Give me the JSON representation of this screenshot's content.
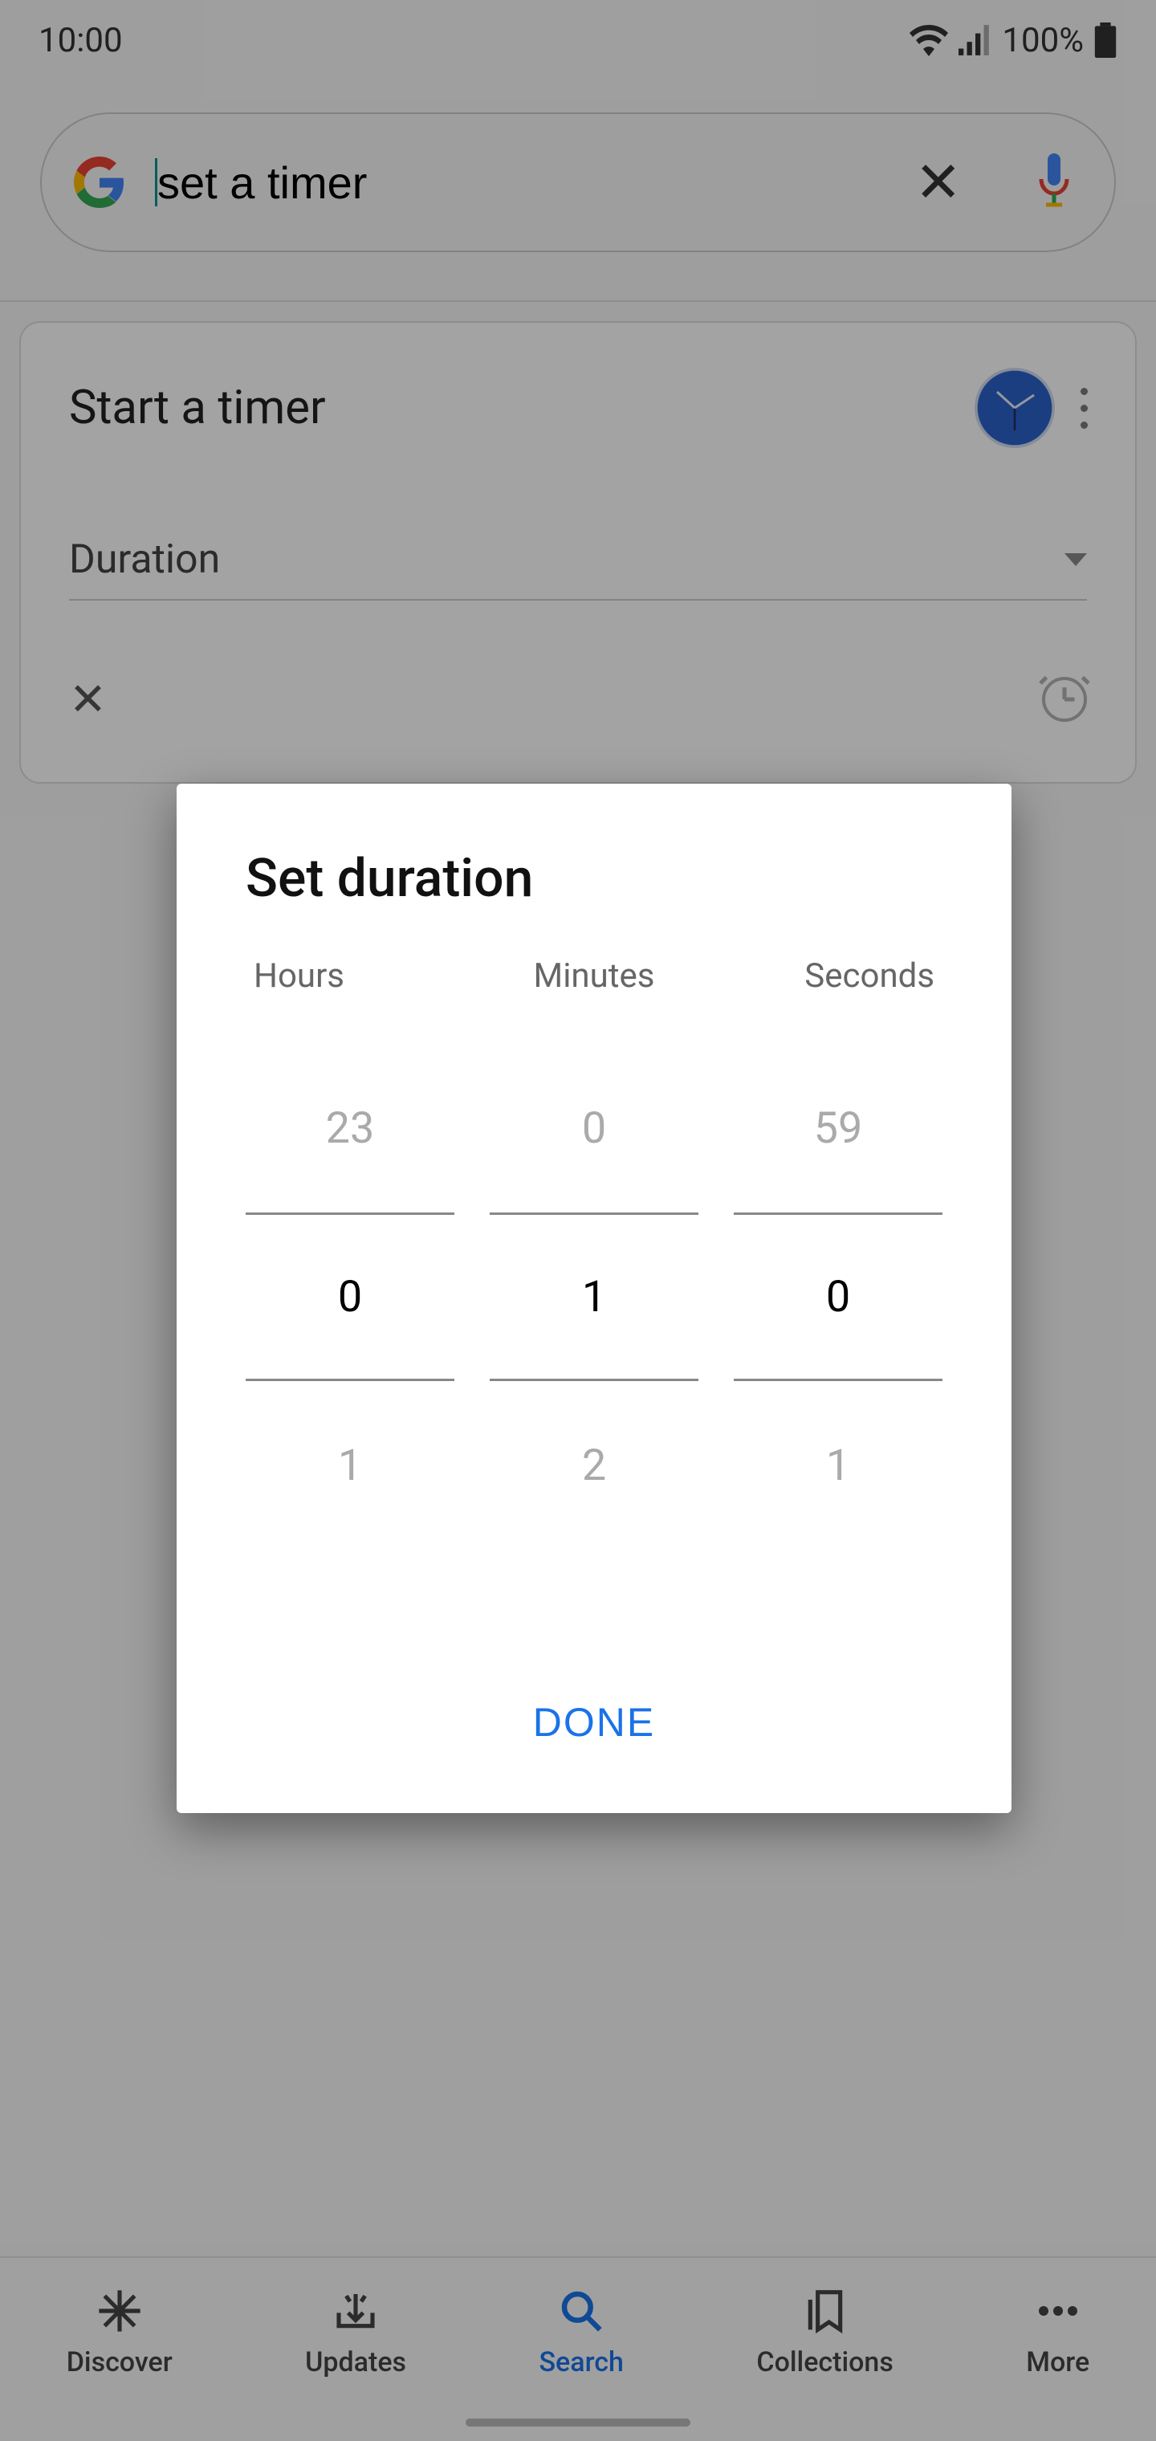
{
  "status": {
    "time": "10:00",
    "battery": "100%"
  },
  "search": {
    "query": "set a timer",
    "placeholder": ""
  },
  "timer_card": {
    "title": "Start a timer",
    "duration_label": "Duration"
  },
  "dialog": {
    "title": "Set duration",
    "columns": [
      "Hours",
      "Minutes",
      "Seconds"
    ],
    "pickers": {
      "hours": {
        "prev": "23",
        "current": "0",
        "next": "1"
      },
      "minutes": {
        "prev": "0",
        "current": "1",
        "next": "2"
      },
      "seconds": {
        "prev": "59",
        "current": "0",
        "next": "1"
      }
    },
    "done_label": "DONE"
  },
  "nav": {
    "items": [
      {
        "label": "Discover"
      },
      {
        "label": "Updates"
      },
      {
        "label": "Search"
      },
      {
        "label": "Collections"
      },
      {
        "label": "More"
      }
    ],
    "active_index": 2
  }
}
